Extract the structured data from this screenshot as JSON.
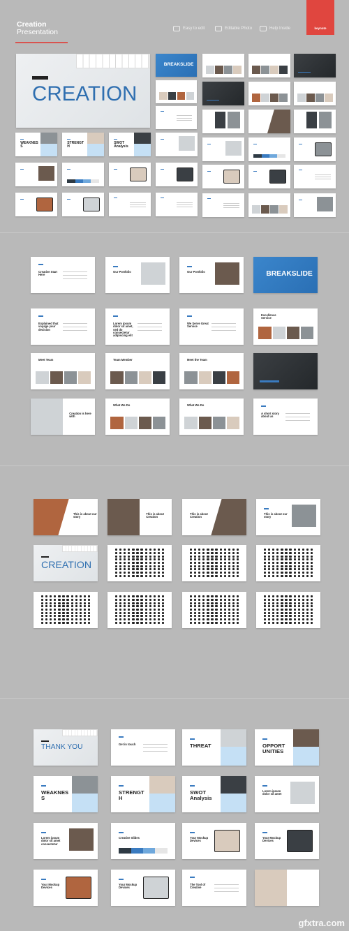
{
  "header": {
    "title_line1": "Creation",
    "title_line2": "Presentation",
    "badge": "keynote",
    "features": [
      {
        "icon": "edit-icon",
        "label": "Easy to edit"
      },
      {
        "icon": "photo-icon",
        "label": "Editable Photo"
      },
      {
        "icon": "help-icon",
        "label": "Help Inside"
      }
    ]
  },
  "colors": {
    "background": "#b9b9b9",
    "accent_blue": "#3a7bc0",
    "accent_red": "#e0463f",
    "light_blue": "#c5e0f5"
  },
  "watermark": "gfxtra.com",
  "sections": [
    {
      "slides": [
        {
          "variant": "hero",
          "title": "CREATION"
        },
        {
          "variant": "blue",
          "title": "BREAKSLIDE"
        },
        {
          "variant": "photos",
          "title": ""
        },
        {
          "variant": "photos",
          "title": ""
        },
        {
          "variant": "dark",
          "title": ""
        },
        {
          "variant": "photos",
          "title": ""
        },
        {
          "variant": "dark",
          "title": ""
        },
        {
          "variant": "photos",
          "title": ""
        },
        {
          "variant": "photos",
          "title": ""
        },
        {
          "variant": "text",
          "title": ""
        },
        {
          "variant": "split",
          "title": ""
        },
        {
          "variant": "diag",
          "title": ""
        },
        {
          "variant": "split",
          "title": ""
        },
        {
          "variant": "photo-right",
          "title": ""
        },
        {
          "variant": "bars",
          "title": ""
        },
        {
          "variant": "device",
          "title": ""
        },
        {
          "variant": "device",
          "title": ""
        },
        {
          "variant": "device",
          "title": ""
        },
        {
          "variant": "text",
          "title": ""
        },
        {
          "variant": "text",
          "title": ""
        },
        {
          "variant": "photos",
          "title": ""
        },
        {
          "variant": "photo-right",
          "title": ""
        },
        {
          "variant": "swot",
          "title": "WEAKNES S"
        },
        {
          "variant": "swot",
          "title": "STRENGT H"
        },
        {
          "variant": "swot",
          "title": "SWOT Analysis"
        },
        {
          "variant": "photo-right",
          "title": ""
        },
        {
          "variant": "photo-right",
          "title": ""
        },
        {
          "variant": "bars",
          "title": ""
        },
        {
          "variant": "device",
          "title": ""
        },
        {
          "variant": "device",
          "title": ""
        },
        {
          "variant": "device",
          "title": ""
        },
        {
          "variant": "device",
          "title": ""
        },
        {
          "variant": "text",
          "title": ""
        },
        {
          "variant": "text",
          "title": ""
        }
      ]
    },
    {
      "slides": [
        {
          "variant": "text",
          "title": "Creative Start Here"
        },
        {
          "variant": "photo-right",
          "title": "Our Portfolio"
        },
        {
          "variant": "photo-right",
          "title": "Our Portfolio"
        },
        {
          "variant": "blue",
          "title": "BREAKSLIDE"
        },
        {
          "variant": "text",
          "title": "Explained that voyage your decision"
        },
        {
          "variant": "text",
          "title": "Lorem ipsum dolor sit amet, sed do consectetur adipiscing elit"
        },
        {
          "variant": "text",
          "title": "We Serve Great Service"
        },
        {
          "variant": "photos",
          "title": "Excellence Service"
        },
        {
          "variant": "photos",
          "title": "Meet Team"
        },
        {
          "variant": "photos",
          "title": "Team Member"
        },
        {
          "variant": "photos",
          "title": "Meet the Team"
        },
        {
          "variant": "dark",
          "title": ""
        },
        {
          "variant": "photo-left",
          "title": "Creation is here with"
        },
        {
          "variant": "photos",
          "title": "What We Do"
        },
        {
          "variant": "photos",
          "title": "What We Do"
        },
        {
          "variant": "text",
          "title": "A short story about us"
        }
      ]
    },
    {
      "slides": [
        {
          "variant": "diag-left",
          "title": "This is about our story"
        },
        {
          "variant": "photo-left",
          "title": "This is about Creation"
        },
        {
          "variant": "diag",
          "title": "This is about Creation"
        },
        {
          "variant": "photo-right",
          "title": "This is about our story"
        },
        {
          "variant": "hero",
          "title": "CREATION"
        },
        {
          "variant": "icons",
          "title": ""
        },
        {
          "variant": "icons",
          "title": ""
        },
        {
          "variant": "icons",
          "title": ""
        },
        {
          "variant": "icons",
          "title": ""
        },
        {
          "variant": "icons",
          "title": ""
        },
        {
          "variant": "icons",
          "title": ""
        },
        {
          "variant": "icons",
          "title": ""
        }
      ]
    },
    {
      "slides": [
        {
          "variant": "hero",
          "title": "THANK YOU"
        },
        {
          "variant": "text",
          "title": "Get in touch"
        },
        {
          "variant": "swot",
          "title": "THREAT"
        },
        {
          "variant": "swot",
          "title": "OPPORT UNITIES"
        },
        {
          "variant": "swot",
          "title": "WEAKNES S"
        },
        {
          "variant": "swot",
          "title": "STRENGT H"
        },
        {
          "variant": "swot",
          "title": "SWOT Analysis"
        },
        {
          "variant": "photo-right",
          "title": "Lorem ipsum dolor sit amet"
        },
        {
          "variant": "photo-right",
          "title": "Lorem ipsum dolor sit amet consectetur"
        },
        {
          "variant": "bars",
          "title": "Creative Slides"
        },
        {
          "variant": "device",
          "title": "Your Mockup Devices"
        },
        {
          "variant": "device",
          "title": "Your Mockup Devices"
        },
        {
          "variant": "device",
          "title": "Your Mockup Devices"
        },
        {
          "variant": "device",
          "title": "Your Mockup Devices"
        },
        {
          "variant": "text",
          "title": "The Tool of Creative"
        },
        {
          "variant": "photo-left",
          "title": ""
        }
      ]
    }
  ]
}
